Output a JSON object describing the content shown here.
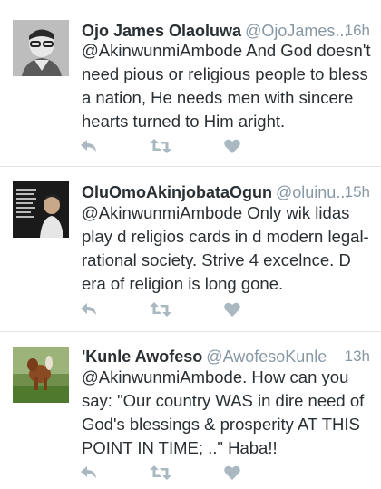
{
  "tweets": [
    {
      "name": "Ojo James Olaoluwa",
      "handle": "@OjoJames...",
      "time": "16h",
      "text": "@AkinwunmiAmbode And God doesn't\nneed pious or religious people to bless\na nation, He needs men with sincere\nhearts turned to Him aright.",
      "avatar_icon": "user-photo-glasses"
    },
    {
      "name": "OluOmoAkinjobataOgun",
      "handle": "@oluinu...",
      "time": "15h",
      "text": "@AkinwunmiAmbode Only wik lidas\nplay d religios cards in d modern legal-\nrational society. Strive 4 excelnce. D\nera of religion is long gone.",
      "avatar_icon": "user-photo-quote-card"
    },
    {
      "name": "'Kunle Awofeso",
      "handle": "@AwofesoKunle",
      "time": "13h",
      "text": "@AkinwunmiAmbode. How can you\nsay: \"Our country WAS in dire need of\nGod's blessings & prosperity AT THIS\nPOINT IN TIME; ..\" Haba!!",
      "avatar_icon": "user-photo-dog"
    }
  ],
  "icons": {
    "reply": "reply-icon",
    "retweet": "retweet-icon",
    "like": "heart-icon"
  },
  "colors": {
    "text": "#292f33",
    "secondary": "#8899a6",
    "action_icon": "#aab8c2",
    "divider": "#e1e8ed"
  }
}
